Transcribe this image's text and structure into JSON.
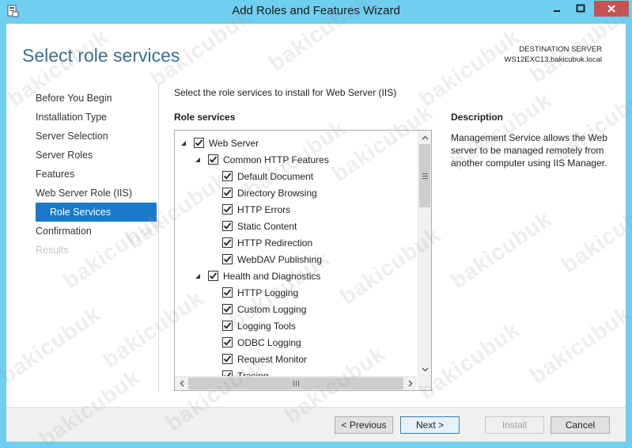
{
  "window": {
    "title": "Add Roles and Features Wizard"
  },
  "page": {
    "title": "Select role services"
  },
  "destination": {
    "label": "DESTINATION SERVER",
    "server": "WS12EXC13.bakicubuk.local"
  },
  "nav": {
    "items": [
      {
        "label": "Before You Begin",
        "state": "normal"
      },
      {
        "label": "Installation Type",
        "state": "normal"
      },
      {
        "label": "Server Selection",
        "state": "normal"
      },
      {
        "label": "Server Roles",
        "state": "normal"
      },
      {
        "label": "Features",
        "state": "normal"
      },
      {
        "label": "Web Server Role (IIS)",
        "state": "normal"
      },
      {
        "label": "Role Services",
        "state": "selected"
      },
      {
        "label": "Confirmation",
        "state": "normal"
      },
      {
        "label": "Results",
        "state": "disabled"
      }
    ]
  },
  "instruction": "Select the role services to install for Web Server (IIS)",
  "role_services": {
    "header": "Role services",
    "items": [
      {
        "label": "Web Server",
        "level": 0,
        "expanded": true,
        "checked": true
      },
      {
        "label": "Common HTTP Features",
        "level": 1,
        "expanded": true,
        "checked": true
      },
      {
        "label": "Default Document",
        "level": 2,
        "checked": true
      },
      {
        "label": "Directory Browsing",
        "level": 2,
        "checked": true
      },
      {
        "label": "HTTP Errors",
        "level": 2,
        "checked": true
      },
      {
        "label": "Static Content",
        "level": 2,
        "checked": true
      },
      {
        "label": "HTTP Redirection",
        "level": 2,
        "checked": true
      },
      {
        "label": "WebDAV Publishing",
        "level": 2,
        "checked": true
      },
      {
        "label": "Health and Diagnostics",
        "level": 1,
        "expanded": true,
        "checked": true
      },
      {
        "label": "HTTP Logging",
        "level": 2,
        "checked": true
      },
      {
        "label": "Custom Logging",
        "level": 2,
        "checked": true
      },
      {
        "label": "Logging Tools",
        "level": 2,
        "checked": true
      },
      {
        "label": "ODBC Logging",
        "level": 2,
        "checked": true
      },
      {
        "label": "Request Monitor",
        "level": 2,
        "checked": true
      },
      {
        "label": "Tracing",
        "level": 2,
        "checked": true
      }
    ]
  },
  "description": {
    "header": "Description",
    "text": "Management Service allows the Web server to be managed remotely from another computer using IIS Manager."
  },
  "buttons": {
    "previous": "< Previous",
    "next": "Next >",
    "install": "Install",
    "cancel": "Cancel"
  },
  "watermark": "bakicubuk",
  "colors": {
    "accent": "#1979ca",
    "title": "#3c6f8f",
    "frame": "#6ecff0",
    "close": "#c75050"
  }
}
